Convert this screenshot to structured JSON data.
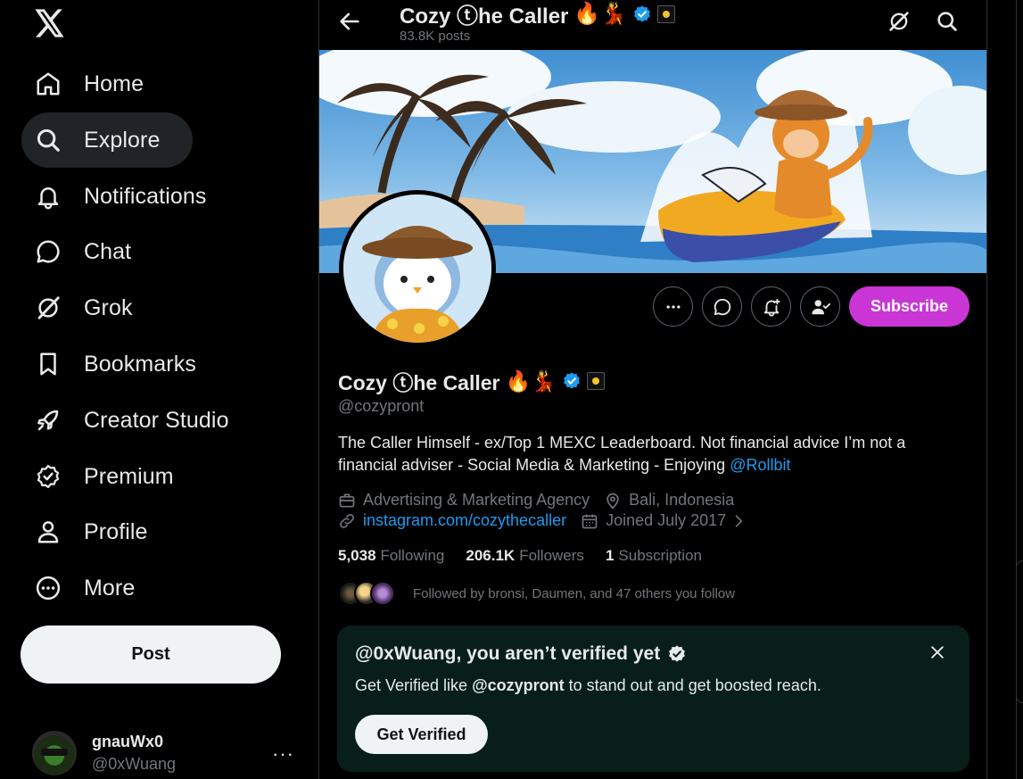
{
  "nav": {
    "items": [
      {
        "label": "Home",
        "icon": "home-icon"
      },
      {
        "label": "Explore",
        "icon": "search-icon"
      },
      {
        "label": "Notifications",
        "icon": "bell-icon"
      },
      {
        "label": "Chat",
        "icon": "chat-icon"
      },
      {
        "label": "Grok",
        "icon": "grok-icon"
      },
      {
        "label": "Bookmarks",
        "icon": "bookmark-icon"
      },
      {
        "label": "Creator Studio",
        "icon": "rocket-icon"
      },
      {
        "label": "Premium",
        "icon": "verified-badge-icon"
      },
      {
        "label": "Profile",
        "icon": "person-icon"
      },
      {
        "label": "More",
        "icon": "more-circle-icon"
      }
    ],
    "active": "Explore",
    "post_label": "Post"
  },
  "account": {
    "name": "gnauWx0",
    "handle": "@0xWuang",
    "more": "···"
  },
  "header": {
    "name": "Cozy ⓣhe Caller",
    "emojis": "🔥💃",
    "posts": "83.8K posts"
  },
  "profile": {
    "name": "Cozy ⓣhe Caller",
    "emojis": "🔥💃",
    "handle": "@cozypront",
    "bio_text": "The Caller Himself - ex/Top 1 MEXC Leaderboard. Not financial advice I’m not a financial adviser - Social Media & Marketing - Enjoying ",
    "bio_link": "@Rollbit",
    "category": "Advertising & Marketing Agency",
    "location": "Bali, Indonesia",
    "website": "instagram.com/cozythecaller",
    "joined": "Joined July 2017",
    "following_count": "5,038",
    "following_label": "Following",
    "followers_count": "206.1K",
    "followers_label": "Followers",
    "subscriptions_count": "1",
    "subscriptions_label": "Subscription",
    "followed_by": "Followed by bronsi, Daumen, and 47 others you follow",
    "subscribe_label": "Subscribe"
  },
  "verify_card": {
    "title": "@0xWuang, you aren’t verified yet",
    "text_pre": "Get Verified like ",
    "text_handle": "@cozypront",
    "text_post": " to stand out and get boosted reach.",
    "button": "Get Verified"
  },
  "colors": {
    "accent": "#1d9bf0",
    "subscribe": "#c936d5",
    "verify_bg": "#071f18",
    "muted": "#71767b"
  }
}
